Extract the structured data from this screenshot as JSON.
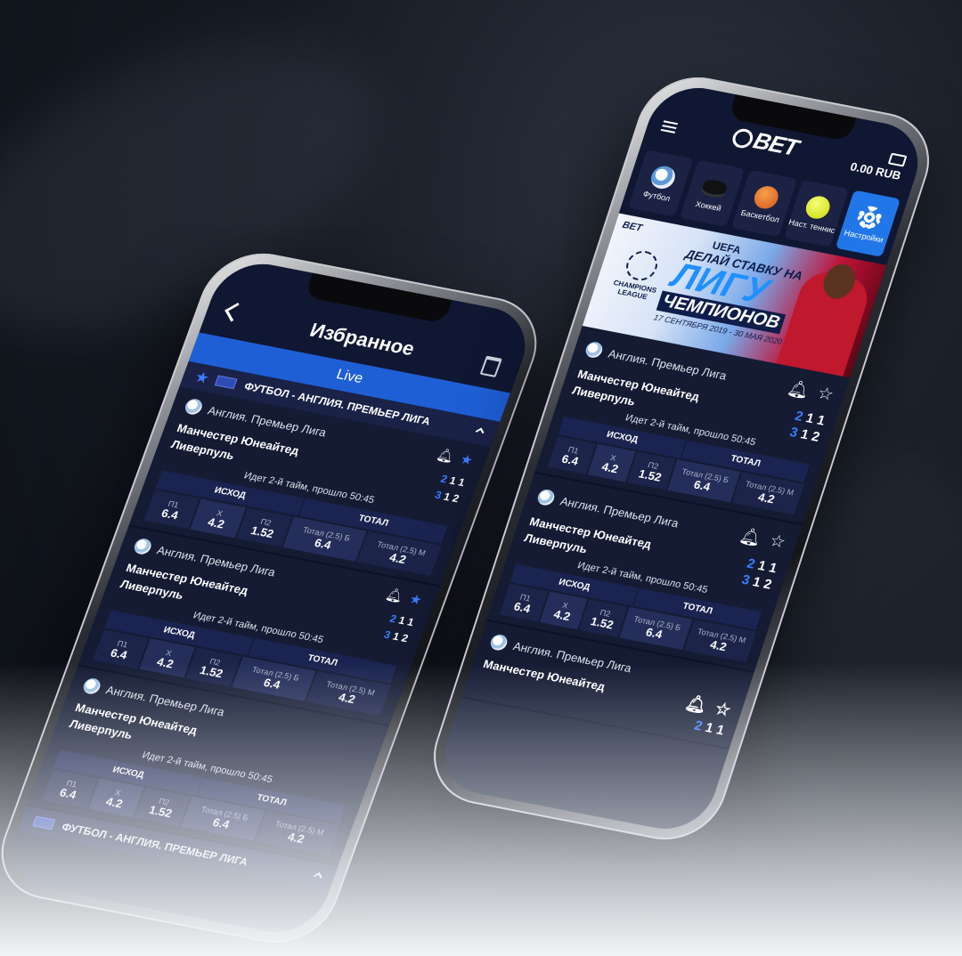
{
  "left_phone": {
    "header": {
      "title": "Избранное"
    },
    "live_label": "Live",
    "league": {
      "title": "ФУТБОЛ - АНГЛИЯ. ПРЕМЬЕР ЛИГА"
    },
    "matches": [
      {
        "league": "Англия. Премьер Лига",
        "team1": "Манчестер Юнеайтед",
        "team2": "Ливерпуль",
        "score1": [
          "2",
          "1",
          "1"
        ],
        "score2": [
          "3",
          "1",
          "2"
        ],
        "status": "Идет 2-й тайм, прошло 50:45",
        "market1": "ИСХОД",
        "market2": "ТОТАЛ",
        "odds": [
          {
            "label": "П1",
            "value": "6.4"
          },
          {
            "label": "X",
            "value": "4.2"
          },
          {
            "label": "П2",
            "value": "1.52"
          },
          {
            "label": "Тотал (2.5) Б",
            "value": "6.4"
          },
          {
            "label": "Тотал (2.5) М",
            "value": "4.2"
          }
        ]
      },
      {
        "league": "Англия. Премьер Лига",
        "team1": "Манчестер Юнеайтед",
        "team2": "Ливерпуль",
        "score1": [
          "2",
          "1",
          "1"
        ],
        "score2": [
          "3",
          "1",
          "2"
        ],
        "status": "Идет 2-й тайм, прошло 50:45",
        "market1": "ИСХОД",
        "market2": "ТОТАЛ",
        "odds": [
          {
            "label": "П1",
            "value": "6.4"
          },
          {
            "label": "X",
            "value": "4.2"
          },
          {
            "label": "П2",
            "value": "1.52"
          },
          {
            "label": "Тотал (2.5) Б",
            "value": "6.4"
          },
          {
            "label": "Тотал (2.5) М",
            "value": "4.2"
          }
        ]
      },
      {
        "league": "Англия. Премьер Лига",
        "team1": "Манчестер Юнеайтед",
        "team2": "Ливерпуль",
        "status": "Идет 2-й тайм, прошло 50:45",
        "market1": "ИСХОД",
        "market2": "ТОТАЛ",
        "odds": [
          {
            "label": "П1",
            "value": "6.4"
          },
          {
            "label": "X",
            "value": "4.2"
          },
          {
            "label": "П2",
            "value": "1.52"
          },
          {
            "label": "Тотал (2.5) Б",
            "value": "6.4"
          },
          {
            "label": "Тотал (2.5) М",
            "value": "4.2"
          }
        ]
      }
    ],
    "league_footer": "ФУТБОЛ - АНГЛИЯ. ПРЕМЬЕР ЛИГА"
  },
  "right_phone": {
    "logo": "BET",
    "balance": "0.00 RUB",
    "sports": [
      {
        "label": "Футбол",
        "icon": "football-icon"
      },
      {
        "label": "Хоккей",
        "icon": "hockey-icon"
      },
      {
        "label": "Баскетбол",
        "icon": "basketball-icon"
      },
      {
        "label": "Наст. теннис",
        "icon": "tennis-icon"
      },
      {
        "label": "Настройки",
        "icon": "gear-icon"
      }
    ],
    "banner": {
      "logo": "BET",
      "uefa": "UEFA",
      "line1": "ДЕЛАЙ СТАВКУ НА",
      "line2": "ЛИГУ",
      "line3": "ЧЕМПИОНОВ",
      "dates": "17 СЕНТЯБРЯ 2019 - 30 МАЯ 2020",
      "ucl": "CHAMPIONS LEAGUE"
    },
    "matches": [
      {
        "league": "Англия. Премьер Лига",
        "team1": "Манчестер Юнеайтед",
        "team2": "Ливерпуль",
        "score1": [
          "2",
          "1",
          "1"
        ],
        "score2": [
          "3",
          "1",
          "2"
        ],
        "status": "Идет 2-й тайм, прошло 50:45",
        "market1": "ИСХОД",
        "market2": "ТОТАЛ",
        "odds": [
          {
            "label": "П1",
            "value": "6.4"
          },
          {
            "label": "X",
            "value": "4.2"
          },
          {
            "label": "П2",
            "value": "1.52"
          },
          {
            "label": "Тотал (2.5) Б",
            "value": "6.4"
          },
          {
            "label": "Тотал (2.5) М",
            "value": "4.2"
          }
        ]
      },
      {
        "league": "Англия. Премьер Лига",
        "team1": "Манчестер Юнеайтед",
        "team2": "Ливерпуль",
        "score1": [
          "2",
          "1",
          "1"
        ],
        "score2": [
          "3",
          "1",
          "2"
        ],
        "status": "Идет 2-й тайм, прошло 50:45",
        "market1": "ИСХОД",
        "market2": "ТОТАЛ",
        "odds": [
          {
            "label": "П1",
            "value": "6.4"
          },
          {
            "label": "X",
            "value": "4.2"
          },
          {
            "label": "П2",
            "value": "1.52"
          },
          {
            "label": "Тотал (2.5) Б",
            "value": "6.4"
          },
          {
            "label": "Тотал (2.5) М",
            "value": "4.2"
          }
        ]
      },
      {
        "league": "Англия. Премьер Лига",
        "team1": "Манчестер Юнеайтед",
        "score1": [
          "2",
          "1",
          "1"
        ]
      }
    ]
  }
}
